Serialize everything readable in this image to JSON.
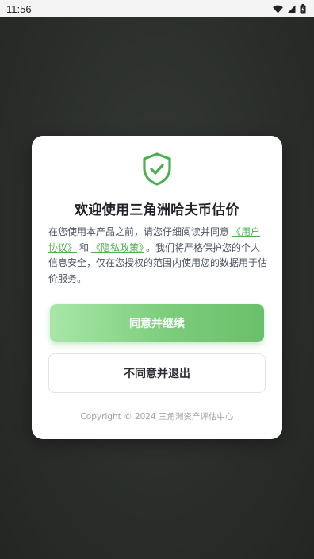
{
  "status_bar": {
    "time": "11:56",
    "icons": [
      "wifi-icon",
      "signal-icon",
      "battery-icon"
    ]
  },
  "dialog": {
    "icon": "shield-check-icon",
    "title": "欢迎使用三角洲哈夫币估价",
    "description": {
      "intro": "在您使用本产品之前，请您仔细阅读并同意",
      "user_agreement_link": "《用户协议》",
      "and": "和",
      "privacy_policy_link": "《隐私政策》",
      "outro": "。我们将严格保护您的个人信息安全，仅在您授权的范围内使用您的数据用于估价服务。"
    },
    "agree_button": "同意并继续",
    "disagree_button": "不同意并退出",
    "copyright": "Copyright © 2024 三角洲资产评估中心"
  },
  "colors": {
    "accent_green": "#4caf50",
    "button_gradient_start": "#a8e6a8",
    "button_gradient_end": "#6abf6a",
    "overlay_background": "#2b2e2b"
  }
}
